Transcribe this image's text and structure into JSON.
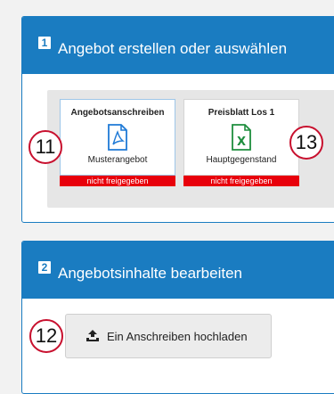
{
  "panel1": {
    "step": "1",
    "title": "Angebot erstellen oder auswählen",
    "documents": [
      {
        "title": "Angebotsanschreiben",
        "icon": "pdf-file-icon",
        "subtitle": "Musterangebot",
        "status": "nicht freigegeben"
      },
      {
        "title": "Preisblatt Los 1",
        "icon": "excel-file-icon",
        "subtitle": "Hauptgegenstand",
        "status": "nicht freigegeben"
      }
    ]
  },
  "panel2": {
    "step": "2",
    "title": "Angebotsinhalte bearbeiten",
    "upload_button": {
      "label": "Ein Anschreiben hochladen",
      "icon": "upload-icon"
    }
  },
  "markers": [
    "11",
    "13",
    "12"
  ],
  "colors": {
    "accent": "#1a7cc1",
    "status_red": "#e8000b",
    "pdf_blue": "#1f7ad6",
    "excel_green": "#1e8e3e",
    "marker_red": "#c8102e"
  }
}
